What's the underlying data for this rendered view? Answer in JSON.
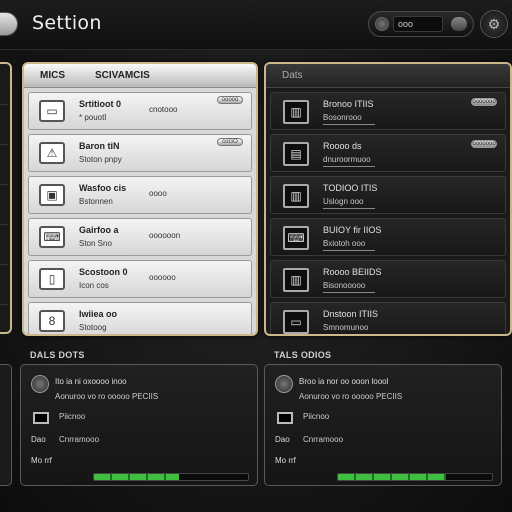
{
  "header": {
    "title": "Settion",
    "search_value": "ooo"
  },
  "left_panel": {
    "headers": [
      "MICS",
      "SCIVAMCIS"
    ],
    "rows": [
      {
        "icon": "monitor-icon",
        "glyph": "▭",
        "title": "Srtitioot 0",
        "sub": "* pouotl",
        "extra": "cnotooo",
        "tag": "ooooo"
      },
      {
        "icon": "triangle-icon",
        "glyph": "⚠",
        "title": "Baron tiN",
        "sub": "Stoton pnpy",
        "extra": "",
        "tag": "coGO"
      },
      {
        "icon": "image-icon",
        "glyph": "▣",
        "title": "Wasfoo cis",
        "sub": "Bstonnen",
        "extra": "oooo",
        "tag": ""
      },
      {
        "icon": "keyboard-icon",
        "glyph": "⌨",
        "title": "Gairfoo a",
        "sub": "Ston Sno",
        "extra": "oooooon",
        "tag": ""
      },
      {
        "icon": "phone-icon",
        "glyph": "▯",
        "title": "Scostoon 0",
        "sub": "Icon cos",
        "extra": "oooooo",
        "tag": ""
      },
      {
        "icon": "document-icon",
        "glyph": "8",
        "title": "Iwiiea oo",
        "sub": "Stotoog",
        "extra": "",
        "tag": ""
      }
    ]
  },
  "right_panel": {
    "header": "Dats",
    "rows": [
      {
        "icon": "window-icon",
        "glyph": "▥",
        "title": "Bronoo ITIIS",
        "sub": "Bosonrooo",
        "tag": "ooooooo"
      },
      {
        "icon": "phone-icon",
        "glyph": "▤",
        "title": "Roooo ds",
        "sub": "dnuroormuoo",
        "tag": "ooooooo"
      },
      {
        "icon": "window-icon",
        "glyph": "▥",
        "title": "TODIOO ITIS",
        "sub": "Uslogn ooo",
        "tag": ""
      },
      {
        "icon": "keyboard-icon",
        "glyph": "⌨",
        "title": "BUIOY fir IIOS",
        "sub": "Bxiotoh ooo",
        "tag": ""
      },
      {
        "icon": "window-icon",
        "glyph": "▥",
        "title": "Roooo BEIIDS",
        "sub": "Bisonooooo",
        "tag": ""
      },
      {
        "icon": "monitor-icon",
        "glyph": "▭",
        "title": "Dnstoon ITIIS",
        "sub": "Smnomunoo",
        "tag": ""
      }
    ]
  },
  "bottom_left": {
    "label": "DALS DOTS",
    "line1": "Ito ia ni oxoooo inoo",
    "line2": "Aonuroo vo ro ooooo PECIIS",
    "item1": "Piicnoo",
    "item2a": "Dao",
    "item2b": "Cnrramooo",
    "item3": "Mo rrf",
    "progress": 0.55
  },
  "bottom_right": {
    "label": "TALS ODIOS",
    "line1": "Broo ia nor oo ooon loool",
    "line2": "Aonuroo vo ro ooooo PECIIS",
    "item1": "Piicnoo",
    "item2a": "Dao",
    "item2b": "Cnrramooo",
    "item3": "Mo rrf",
    "progress": 0.7
  },
  "colors": {
    "panel_border": "#c9b98a",
    "progress": "#3fbf3f"
  }
}
